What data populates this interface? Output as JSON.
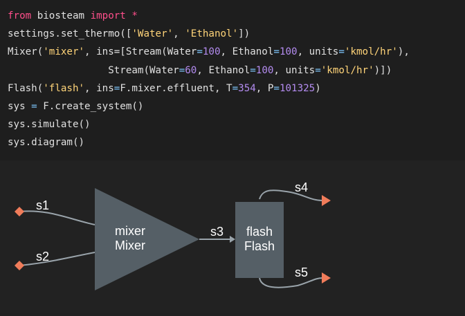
{
  "code": {
    "line1": {
      "kw_from": "from",
      "module": " biosteam ",
      "kw_import": "import",
      "star": " *"
    },
    "line2": {
      "prefix": "settings.set_thermo([",
      "s1": "'Water'",
      "sep": ", ",
      "s2": "'Ethanol'",
      "suffix": "])"
    },
    "line3": {
      "prefix": "Mixer(",
      "id": "'mixer'",
      "mid1": ", ins=[Stream(Water",
      "eq1": "=",
      "v1": "100",
      "mid2": ", Ethanol",
      "eq2": "=",
      "v2": "100",
      "mid3": ", units",
      "eq3": "=",
      "unit": "'kmol/hr'",
      "suffix": "),"
    },
    "line4": {
      "prefix": "                 Stream(Water",
      "eq1": "=",
      "v1": "60",
      "mid2": ", Ethanol",
      "eq2": "=",
      "v2": "100",
      "mid3": ", units",
      "eq3": "=",
      "unit": "'kmol/hr'",
      "suffix": ")])"
    },
    "line5": {
      "prefix": "Flash(",
      "id": "'flash'",
      "mid1": ", ins",
      "eq1": "=",
      "mid1b": "F.mixer.effluent, T",
      "eq2": "=",
      "v1": "354",
      "mid2": ", P",
      "eq3": "=",
      "v2": "101325",
      "suffix": ")"
    },
    "line6": {
      "prefix": "sys ",
      "eq": "=",
      "suffix": " F.create_system()"
    },
    "line7": {
      "text": "sys.simulate()"
    },
    "line8": {
      "text": "sys.diagram()"
    }
  },
  "diagram": {
    "streams": {
      "s1": "s1",
      "s2": "s2",
      "s3": "s3",
      "s4": "s4",
      "s5": "s5"
    },
    "mixer": {
      "id": "mixer",
      "type": "Mixer"
    },
    "flash": {
      "id": "flash",
      "type": "Flash"
    },
    "colors": {
      "unit_fill": "#555f66",
      "stream_line": "#9aa4ab",
      "feed_marker": "#f07c5a",
      "product_marker": "#f07c5a",
      "label": "#ffffff"
    }
  }
}
